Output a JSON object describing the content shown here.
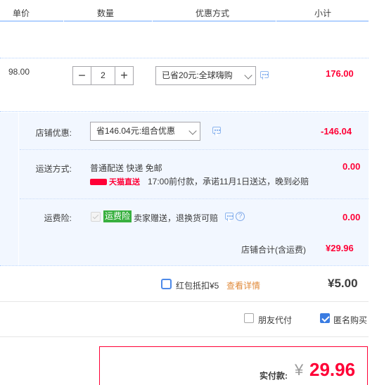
{
  "header": {
    "col_unit_price": "单价",
    "col_quantity": "数量",
    "col_discount": "优惠方式",
    "col_subtotal": "小计"
  },
  "item": {
    "unit_price": "98.00",
    "quantity": "2",
    "minus_label": "−",
    "plus_label": "+",
    "discount_option": "已省20元:全球嗨购",
    "subtotal": "176.00"
  },
  "shop": {
    "discount_label": "店铺优惠:",
    "discount_option": "省146.04元:组合优惠",
    "discount_amount": "-146.04",
    "shipping_label": "运送方式:",
    "shipping_method": "普通配送 快递 免邮",
    "tmall_direct": "天猫直送",
    "shipping_note": "17:00前付款，承诺11月1日送达，晚到必赔",
    "shipping_amount": "0.00",
    "insurance_label": "运费险:",
    "insurance_tag": "运费险",
    "insurance_text": "卖家赠送，退换货可赔",
    "insurance_amount": "0.00",
    "help_glyph": "?",
    "total_label": "店铺合计(含运费)",
    "total_amount": "¥29.96"
  },
  "red_packet": {
    "label": "红包抵扣¥5",
    "details_link": "查看详情",
    "amount": "¥5.00"
  },
  "options": {
    "friend_pay": "朋友代付",
    "anonymous": "匿名购买"
  },
  "payment": {
    "label": "实付款:",
    "currency": "¥",
    "amount": "29.96"
  },
  "colors": {
    "accent_red": "#ff0036",
    "accent_blue": "#3a7ce2",
    "panel_bg": "#f2f7ff",
    "insurance_green": "#38b03f"
  }
}
